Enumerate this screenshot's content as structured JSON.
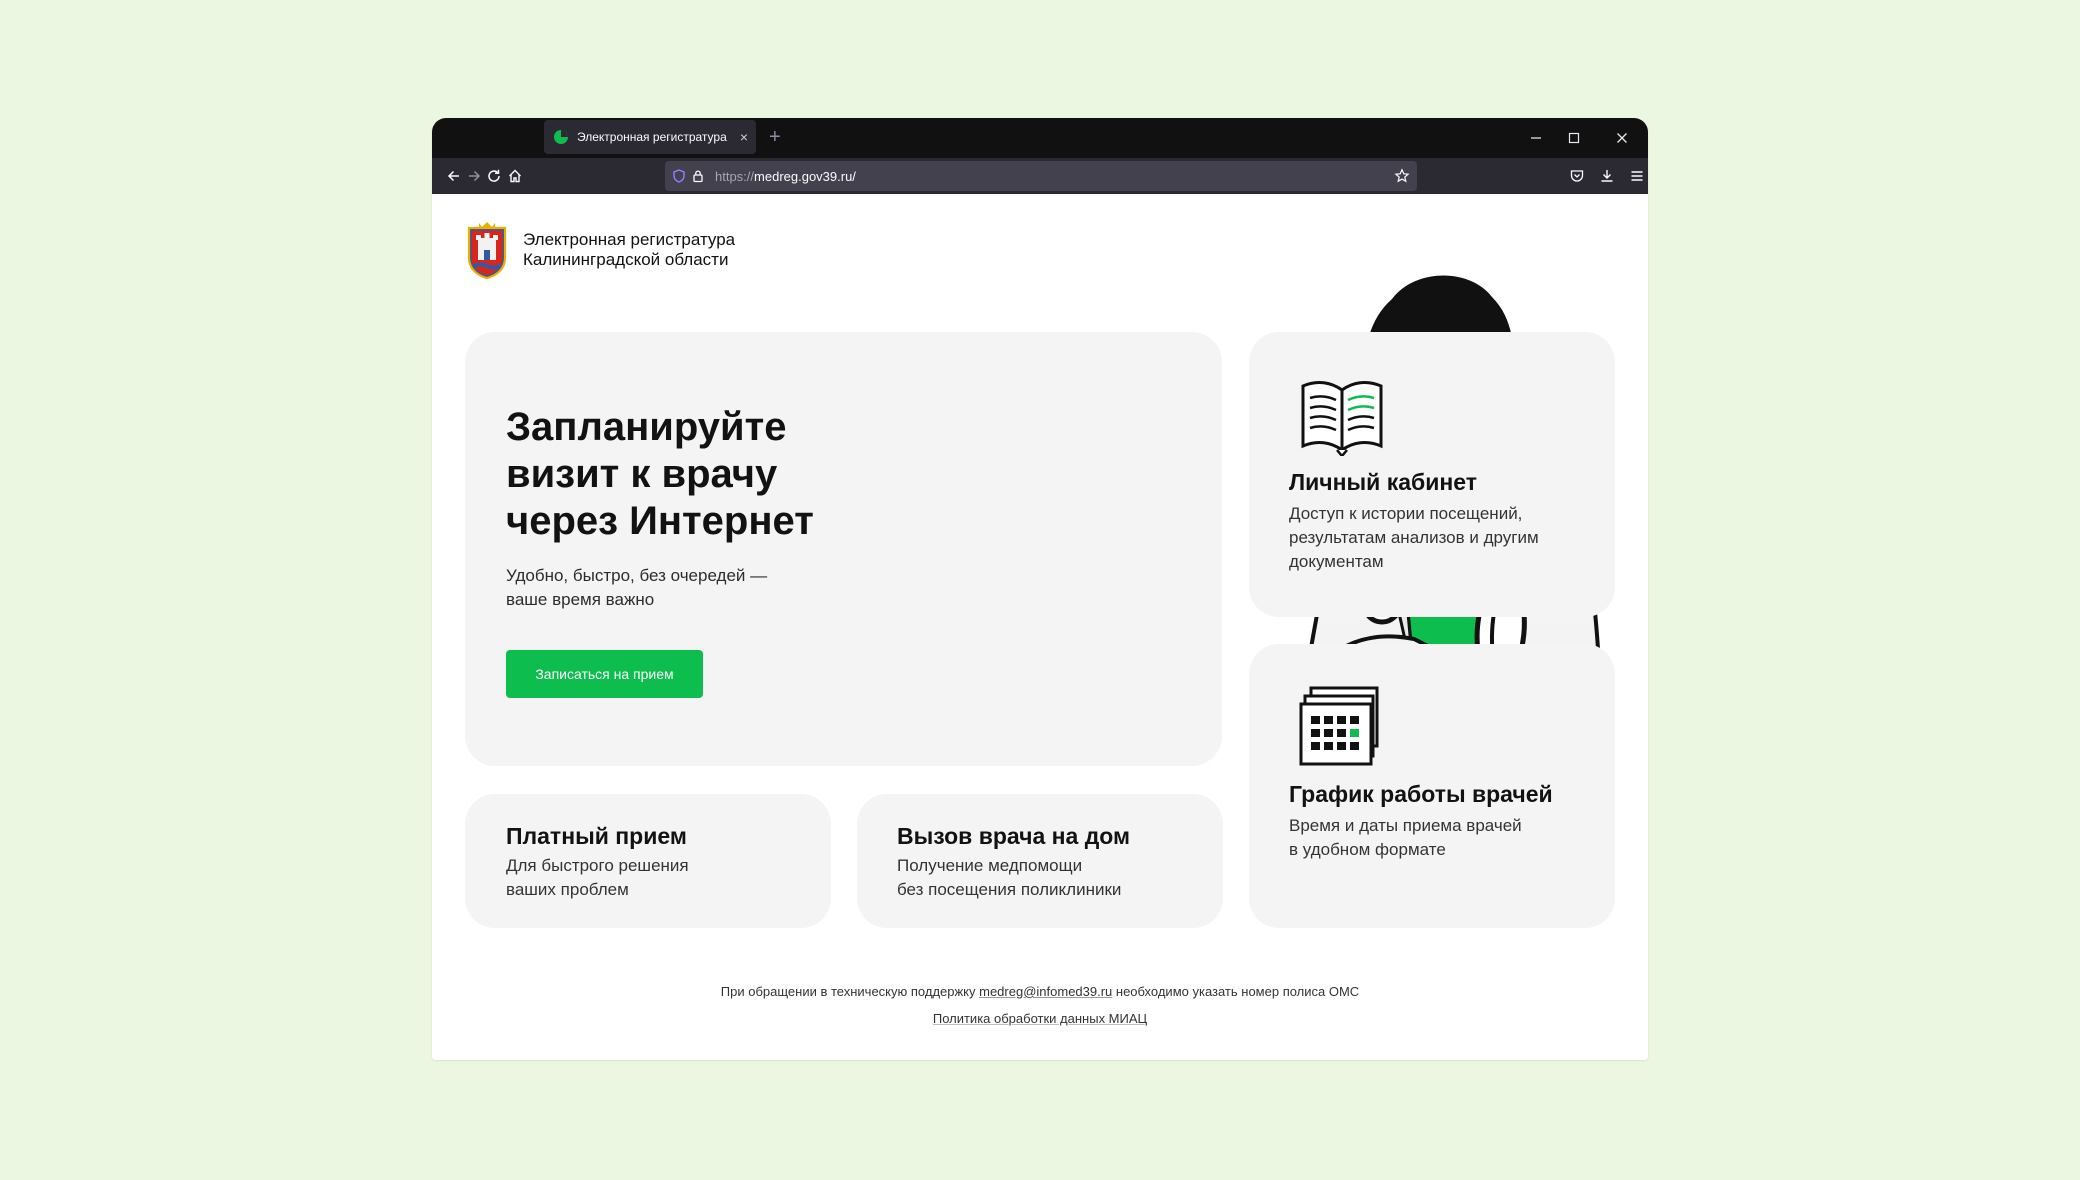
{
  "browser": {
    "tab_title": "Электронная регистратура",
    "new_tab": "+",
    "url_scheme": "https://",
    "url_host": "medreg.gov39.ru/",
    "tab_close": "×"
  },
  "brand": {
    "line1": "Электронная регистратура",
    "line2": "Калининградской области"
  },
  "hero": {
    "title_line1": "Запланируйте",
    "title_line2": "визит к врачу",
    "title_line3": "через Интернет",
    "sub_line1": "Удобно, быстро, без очередей —",
    "sub_line2": "ваше время важно",
    "cta_label": "Записаться на прием"
  },
  "cards": {
    "cabinet": {
      "title": "Личный кабинет",
      "line1": "Доступ к истории посещений,",
      "line2": "результатам анализов и другим",
      "line3": "документам"
    },
    "schedule": {
      "title": "График работы врачей",
      "line1": "Время и даты приема врачей",
      "line2": "в удобном формате"
    },
    "paid": {
      "title": "Платный прием",
      "line1": "Для быстрого решения",
      "line2": "ваших проблем"
    },
    "home_call": {
      "title": "Вызов врача на дом",
      "line1": "Получение медпомощи",
      "line2": "без посещения поликлиники"
    }
  },
  "footer": {
    "support_prefix": "При обращении в техническую поддержку ",
    "support_email": "medreg@infomed39.ru",
    "support_suffix": " необходимо указать номер полиса ОМС",
    "policy_link": "Политика обработки данных МИАЦ"
  },
  "colors": {
    "accent": "#0dbd4d",
    "card_bg": "#f4f4f5",
    "page_bg": "#ebf7e0"
  }
}
